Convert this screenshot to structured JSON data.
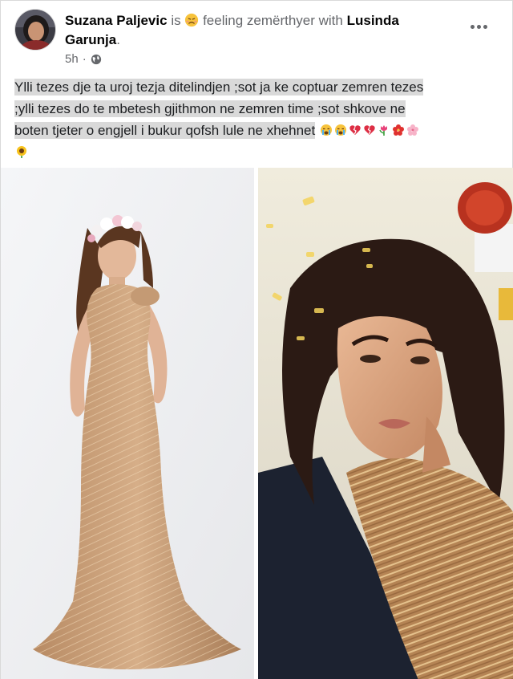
{
  "header": {
    "author": "Suzana Paljevic",
    "is": "is",
    "feeling": "feeling zemërthyer with",
    "tagged_first": "Lusinda",
    "tagged_second": "Garunja",
    "period": ".",
    "time": "5h",
    "privacy_icon": "globe-icon",
    "more_icon": "more-options-icon"
  },
  "post": {
    "line1": "Ylli tezes dje ta uroj tezja ditelindjen ;sot ja ke coptuar zemren tezes",
    "line2": ";ylli tezes do te mbetesh gjithmon ne zemren time ;sot shkove ne",
    "line3": "boten tjeter o engjell i bukur qofsh lule ne xhehnet"
  },
  "colors": {
    "text": "#050505",
    "secondary": "#65676b",
    "highlight": "#d9d9d9"
  }
}
